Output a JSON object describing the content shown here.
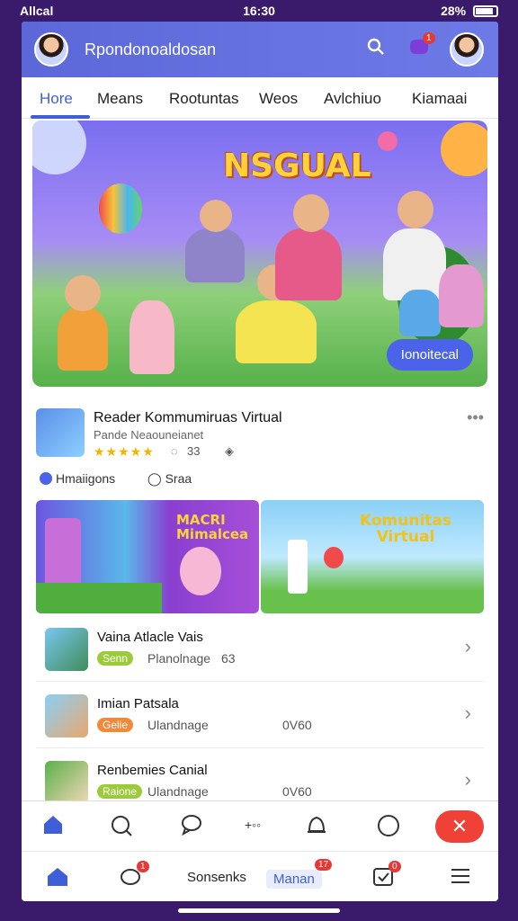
{
  "status_bar": {
    "carrier": "Allcal",
    "time": "16:30",
    "battery": "28%"
  },
  "header": {
    "title": "Rpondonoaldosan",
    "notification_count": "1"
  },
  "tabs": [
    {
      "label": "Hore",
      "active": true
    },
    {
      "label": "Means"
    },
    {
      "label": "Rootuntas"
    },
    {
      "label": "Weos"
    },
    {
      "label": "Avlchiuo"
    },
    {
      "label": "Kiamaai"
    }
  ],
  "hero": {
    "headline": "NSGUAL",
    "cta_label": "Ionoitecal"
  },
  "featured": {
    "title": "Reader Kommumiruas Virtual",
    "subtitle": "Pande Neaouneianet",
    "stars": "★★★★★",
    "views": "33",
    "chips": [
      "Hmaiigons",
      "Sraa"
    ]
  },
  "banners": [
    {
      "label": "MACRI\nMimalcea"
    },
    {
      "label": "Komunitas\nVirtual"
    }
  ],
  "list": [
    {
      "title": "Vaina Atlacle Vais",
      "tag": "Senn",
      "tag_color": "#9ccb3a",
      "meta_left": "Planolnage",
      "meta_right": "63"
    },
    {
      "title": "Imian Patsala",
      "tag": "Gelie",
      "tag_color": "#f08a3a",
      "meta_left": "Ulandnage",
      "meta_right": "0V60"
    },
    {
      "title": "Renbemies Canial",
      "tag": "Raione",
      "tag_color": "#9ccb3a",
      "meta_left": "Ulandnage",
      "meta_right": "0V60"
    }
  ],
  "bottom_nav": {
    "chat_badge": "1",
    "search_label": "Sonsenks",
    "main_label": "Manan",
    "main_badge": "17",
    "task_badge": "0"
  },
  "colors": {
    "primary": "#4b63e8",
    "appbar": "#5c68d8",
    "danger": "#ef4136",
    "background": "#3a1a6a"
  }
}
